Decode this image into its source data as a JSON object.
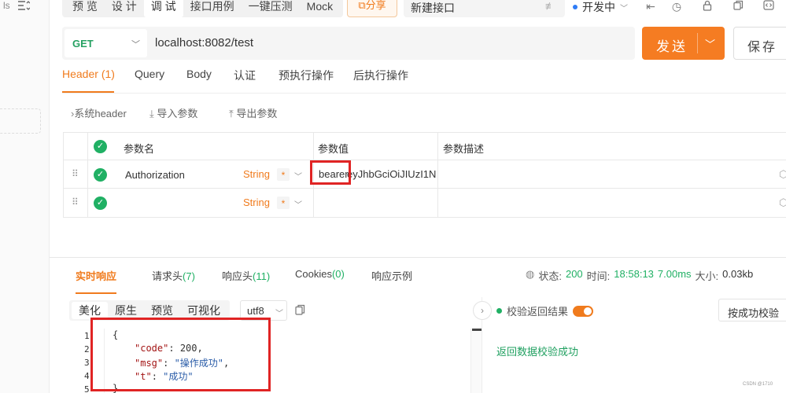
{
  "left_strip": {
    "text": "ls",
    "icon": "filter-sort-icon"
  },
  "top_tabs": [
    "预 览",
    "设 计",
    "调 试",
    "接口用例",
    "一键压测",
    "Mock"
  ],
  "top_tab_active_index": 2,
  "share_label": "⧉分享",
  "api_tab": {
    "title": "新建接口"
  },
  "env": {
    "label": "开发中"
  },
  "request": {
    "method": "GET",
    "url": "localhost:8082/test",
    "send_label": "发送",
    "save_label": "保存"
  },
  "request_tabs": [
    {
      "label": "Header",
      "count": "(1)"
    },
    {
      "label": "Query"
    },
    {
      "label": "Body"
    },
    {
      "label": "认证"
    },
    {
      "label": "预执行操作"
    },
    {
      "label": "后执行操作"
    }
  ],
  "sub_actions": {
    "system_header": "系统header",
    "import": "导入参数",
    "export": "导出参数"
  },
  "params_table": {
    "headers": [
      "参数名",
      "参数值",
      "参数描述"
    ],
    "rows": [
      {
        "name": "Authorization",
        "type": "String",
        "required": "*",
        "value_highlight": "bearer",
        "value_rest": "eyJhbGciOiJIUzI1N"
      },
      {
        "name": "",
        "type": "String",
        "required": "*",
        "value_highlight": "",
        "value_rest": ""
      }
    ]
  },
  "response_tabs": [
    {
      "label": "实时响应"
    },
    {
      "label": "请求头",
      "count": "(7)"
    },
    {
      "label": "响应头",
      "count": "(11)"
    },
    {
      "label": "Cookies",
      "count": "(0)"
    },
    {
      "label": "响应示例"
    }
  ],
  "response_status": {
    "status_label": "状态:",
    "status": "200",
    "time_label": "时间:",
    "time": "18:58:13",
    "duration": "7.00ms",
    "size_label": "大小:",
    "size": "0.03kb"
  },
  "body_views": [
    "美化",
    "原生",
    "预览",
    "可视化"
  ],
  "encoding": "utf8",
  "code_lines": [
    {
      "ln": "1",
      "text": "{"
    },
    {
      "ln": "2",
      "key": "\"code\"",
      "sep": ": ",
      "val": "200",
      "val_type": "num",
      "tail": ","
    },
    {
      "ln": "3",
      "key": "\"msg\"",
      "sep": ": ",
      "val": "\"操作成功\"",
      "val_type": "str",
      "tail": ","
    },
    {
      "ln": "4",
      "key": "\"t\"",
      "sep": ": ",
      "val": "\"成功\"",
      "val_type": "str",
      "tail": ""
    },
    {
      "ln": "5",
      "text": "}"
    }
  ],
  "validation": {
    "label": "校验返回结果",
    "select_label": "按成功校验",
    "result": "返回数据校验成功"
  },
  "watermark": "CSDN @1710",
  "colors": {
    "accent": "#f07b1d",
    "success": "#20b064",
    "get_method": "#26a162",
    "highlight_box": "#e02424"
  }
}
